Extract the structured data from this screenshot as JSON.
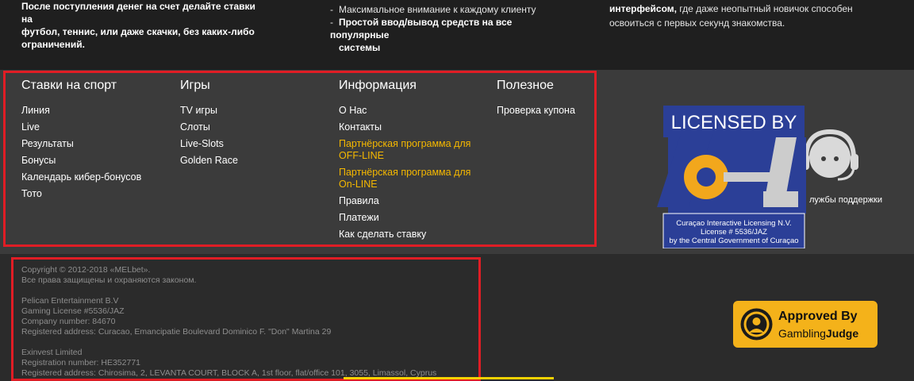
{
  "top": {
    "col1": {
      "line1": "После поступления денег на счет делайте ставки на",
      "line2": "футбол, теннис, или даже скачки, без каких-либо",
      "line3": "ограничений."
    },
    "col2": {
      "dash": "-",
      "item1": "Максимальное внимание к каждому клиенту",
      "item2_line1": "Простой ввод/вывод средств на все популярные",
      "item2_line2": "системы"
    },
    "col3": {
      "bold_part": "интерфейсом,",
      "rest_line1": " где даже неопытный новичок способен",
      "line2": "освоиться с первых секунд знакомства."
    }
  },
  "nav": {
    "sports": {
      "title": "Ставки на спорт",
      "items": [
        "Линия",
        "Live",
        "Результаты",
        "Бонусы",
        "Календарь кибер-бонусов",
        "Тото"
      ]
    },
    "games": {
      "title": "Игры",
      "items": [
        "TV игры",
        "Слоты",
        "Live-Slots",
        "Golden Race"
      ]
    },
    "info": {
      "title": "Информация",
      "items": [
        {
          "label": "О Нас",
          "highlight": false
        },
        {
          "label": "Контакты",
          "highlight": false
        },
        {
          "label": "Партнёрская программа для OFF-LINE",
          "highlight": true
        },
        {
          "label": "Партнёрская программа для On-LINE",
          "highlight": true
        },
        {
          "label": "Правила",
          "highlight": false
        },
        {
          "label": "Платежи",
          "highlight": false
        },
        {
          "label": "Как сделать ставку",
          "highlight": false
        }
      ]
    },
    "useful": {
      "title": "Полезное",
      "items": [
        "Проверка купона"
      ]
    }
  },
  "license": {
    "title": "LICENSED BY",
    "line1": "Curaçao Interactive Licensing N.V.",
    "line2": "License # 5536/JAZ",
    "line3": "by the Central Government of Curaçao"
  },
  "support": {
    "text": "лужбы поддержки",
    "icon": "headset-operator-icon"
  },
  "copyright": {
    "lines": [
      "Copyright © 2012-2018 «MELbet».",
      "Все права защищены и охраняются законом.",
      "",
      "Pelican Entertainment B.V",
      "Gaming License #5536/JAZ",
      "Company number: 84670",
      "Registered address: Curacao, Emancipatie Boulevard Dominico F. \"Don\" Martina 29",
      "",
      "Exinvest Limited",
      "Registration number: HE352771",
      "Registered address: Chirosima, 2, LEVANTA COURT, BLOCK A, 1st floor, flat/office 101, 3055, Limassol, Cyprus"
    ]
  },
  "gambling_judge": {
    "line1": "Approved By",
    "line2_a": "Gambling",
    "line2_b": "Judge"
  },
  "colors": {
    "highlight": "#f5b800",
    "annotation_border": "#e01d25",
    "badge_yellow": "#f4b21a",
    "license_blue": "#2b3f97"
  }
}
